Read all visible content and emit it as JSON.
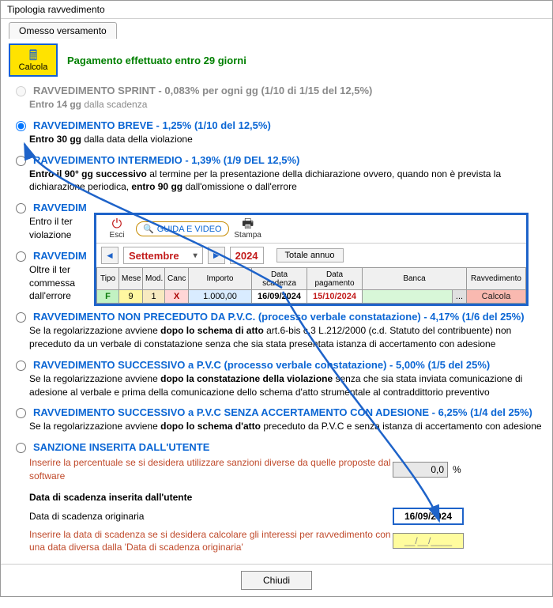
{
  "window": {
    "title": "Tipologia ravvedimento"
  },
  "tab": {
    "label": "Omesso versamento"
  },
  "calc_button": {
    "label": "Calcola"
  },
  "status": {
    "message": "Pagamento effettuato entro 29 giorni"
  },
  "options": {
    "sprint": {
      "title": "RAVVEDIMENTO SPRINT - 0,083% per ogni gg (1/10 di 1/15 del 12,5%)",
      "desc_bold": "Entro 14 gg",
      "desc_rest": " dalla scadenza"
    },
    "breve": {
      "title": "RAVVEDIMENTO BREVE - 1,25% (1/10 del 12,5%)",
      "desc_bold": "Entro 30 gg",
      "desc_rest": " dalla data della violazione"
    },
    "intermedio": {
      "title": "RAVVEDIMENTO INTERMEDIO - 1,39% (1/9 DEL 12,5%)",
      "desc_bold1": "Entro il 90° gg successivo",
      "desc_mid": " al termine per la presentazione della dichiarazione ovvero, quando non è prevista la dichiarazione periodica, ",
      "desc_bold2": "entro 90 gg",
      "desc_end": " dall'omissione o dall'errore"
    },
    "lungo1": {
      "title_prefix": "RAVVEDIM",
      "desc1": "Entro il ter",
      "desc2": "violazione"
    },
    "lungo2": {
      "title_prefix": "RAVVEDIM",
      "desc1": "Oltre il ter",
      "desc2": "commessa",
      "desc3": "dall'errore"
    },
    "non_prec": {
      "title": "RAVVEDIMENTO NON PRECEDUTO DA P.V.C. (processo verbale constatazione) - 4,17% (1/6 del 25%)",
      "desc_pre": "Se la regolarizzazione avviene ",
      "desc_bold": "dopo lo schema di atto",
      "desc_rest": " art.6-bis c.3 L.212/2000 (c.d. Statuto del contribuente) non preceduto da un verbale di constatazione senza che sia stata presentata istanza di accertamento con adesione"
    },
    "succ_pvc": {
      "title": "RAVVEDIMENTO SUCCESSIVO a P.V.C (processo verbale constatazione) - 5,00% (1/5 del 25%)",
      "desc_pre": "Se la regolarizzazione avviene ",
      "desc_bold": "dopo la constatazione della violazione",
      "desc_rest": " senza che sia stata inviata comunicazione di adesione al verbale e prima della comunicazione dello schema d'atto strumentale al contraddittorio preventivo"
    },
    "succ_no_acc": {
      "title": "RAVVEDIMENTO SUCCESSIVO a P.V.C SENZA ACCERTAMENTO CON ADESIONE - 6,25% (1/4 del 25%)",
      "desc_pre": "Se la regolarizzazione avviene ",
      "desc_bold": "dopo lo schema d'atto",
      "desc_rest": " preceduto da P.V.C e senza istanza di accertamento con adesione"
    },
    "utente": {
      "title": "SANZIONE INSERITA DALL'UTENTE",
      "hint1": "Inserire la percentuale se si desidera utilizzare sanzioni diverse da quelle proposte dal software",
      "pct_value": "0,0",
      "pct_suffix": "%",
      "data_head": "Data di scadenza inserita dall'utente",
      "data_label": "Data di scadenza originaria",
      "data_value": "16/09/2024",
      "hint2": "Inserire la data di scadenza se si desidera calcolare gli interessi per ravvedimento con una data diversa dalla 'Data di scadenza originaria'",
      "alt_value": "__/__/____"
    }
  },
  "embedded": {
    "toolbar": {
      "esci": "Esci",
      "guida": "GUIDA E VIDEO",
      "stampa": "Stampa"
    },
    "nav": {
      "month": "Settembre",
      "year": "2024",
      "totale": "Totale annuo"
    },
    "grid": {
      "headers": {
        "tipo": "Tipo",
        "mese": "Mese",
        "mod": "Mod.",
        "canc": "Canc",
        "importo": "Importo",
        "data_scad": "Data scadenza",
        "data_pag": "Data pagamento",
        "banca": "Banca",
        "ravv": "Ravvedimento"
      },
      "row": {
        "tipo": "F",
        "mese": "9",
        "mod": "1",
        "canc": "X",
        "importo": "1.000,00",
        "data_scad": "16/09/2024",
        "data_pag": "15/10/2024",
        "banca": "",
        "banca_btn": "...",
        "ravv": "Calcola"
      }
    }
  },
  "footer": {
    "close": "Chiudi"
  }
}
